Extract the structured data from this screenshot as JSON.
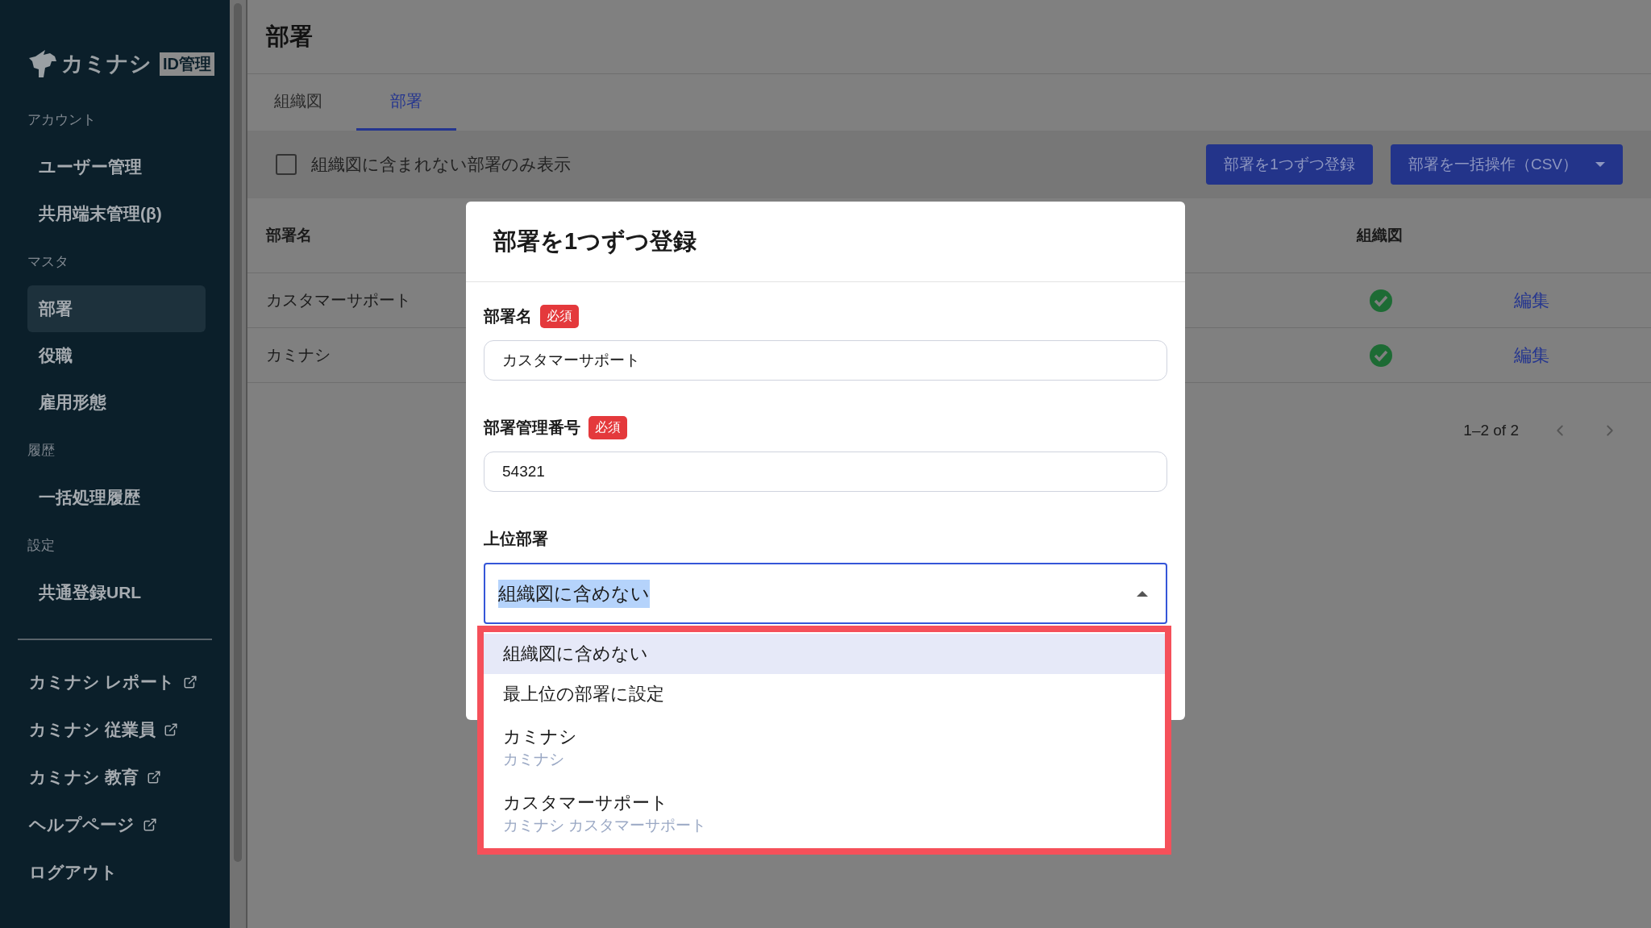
{
  "sidebar": {
    "logo": {
      "text": "カミナシ",
      "badge": "ID管理"
    },
    "sections": [
      {
        "label": "アカウント",
        "items": [
          {
            "label": "ユーザー管理",
            "selected": false
          },
          {
            "label": "共用端末管理(β)",
            "selected": false
          }
        ]
      },
      {
        "label": "マスタ",
        "items": [
          {
            "label": "部署",
            "selected": true
          },
          {
            "label": "役職",
            "selected": false
          },
          {
            "label": "雇用形態",
            "selected": false
          }
        ]
      },
      {
        "label": "履歴",
        "items": [
          {
            "label": "一括処理履歴",
            "selected": false
          }
        ]
      },
      {
        "label": "設定",
        "items": [
          {
            "label": "共通登録URL",
            "selected": false
          }
        ]
      }
    ],
    "links": [
      {
        "label": "カミナシ レポート",
        "external": true
      },
      {
        "label": "カミナシ 従業員",
        "external": true
      },
      {
        "label": "カミナシ 教育",
        "external": true
      },
      {
        "label": "ヘルプページ",
        "external": true
      },
      {
        "label": "ログアウト",
        "external": false
      }
    ]
  },
  "page": {
    "title": "部署",
    "tabs": [
      {
        "label": "組織図",
        "selected": false
      },
      {
        "label": "部署",
        "selected": true
      }
    ],
    "filter": {
      "label": "組織図に含まれない部署のみ表示",
      "checked": false
    },
    "buttons": [
      {
        "label": "部署を1つずつ登録",
        "kind": "plain"
      },
      {
        "label": "部署を一括操作（CSV）",
        "kind": "menu"
      }
    ],
    "table": {
      "columns": [
        "部署名",
        "組織図"
      ],
      "rows": [
        {
          "name": "カスタマーサポート",
          "in_chart": true,
          "action": "編集"
        },
        {
          "name": "カミナシ",
          "in_chart": true,
          "action": "編集"
        }
      ]
    },
    "pagination": {
      "range": "1–2 of 2"
    }
  },
  "modal": {
    "title": "部署を1つずつ登録",
    "fields": [
      {
        "kind": "text",
        "label": "部署名",
        "badge": "必須",
        "value": "カスタマーサポート"
      },
      {
        "kind": "text",
        "label": "部署管理番号",
        "badge": "必須",
        "value": "54321"
      },
      {
        "kind": "select",
        "label": "上位部署",
        "value": "組織図に含めない",
        "expanded": true,
        "options": [
          {
            "label": "組織図に含めない",
            "selected": true
          },
          {
            "label": "最上位の部署に設定",
            "selected": false
          },
          {
            "label": "カミナシ",
            "path": "カミナシ",
            "selected": false
          },
          {
            "label": "カスタマーサポート",
            "path": "カミナシ カスタマーサポート",
            "selected": false
          }
        ]
      }
    ]
  }
}
